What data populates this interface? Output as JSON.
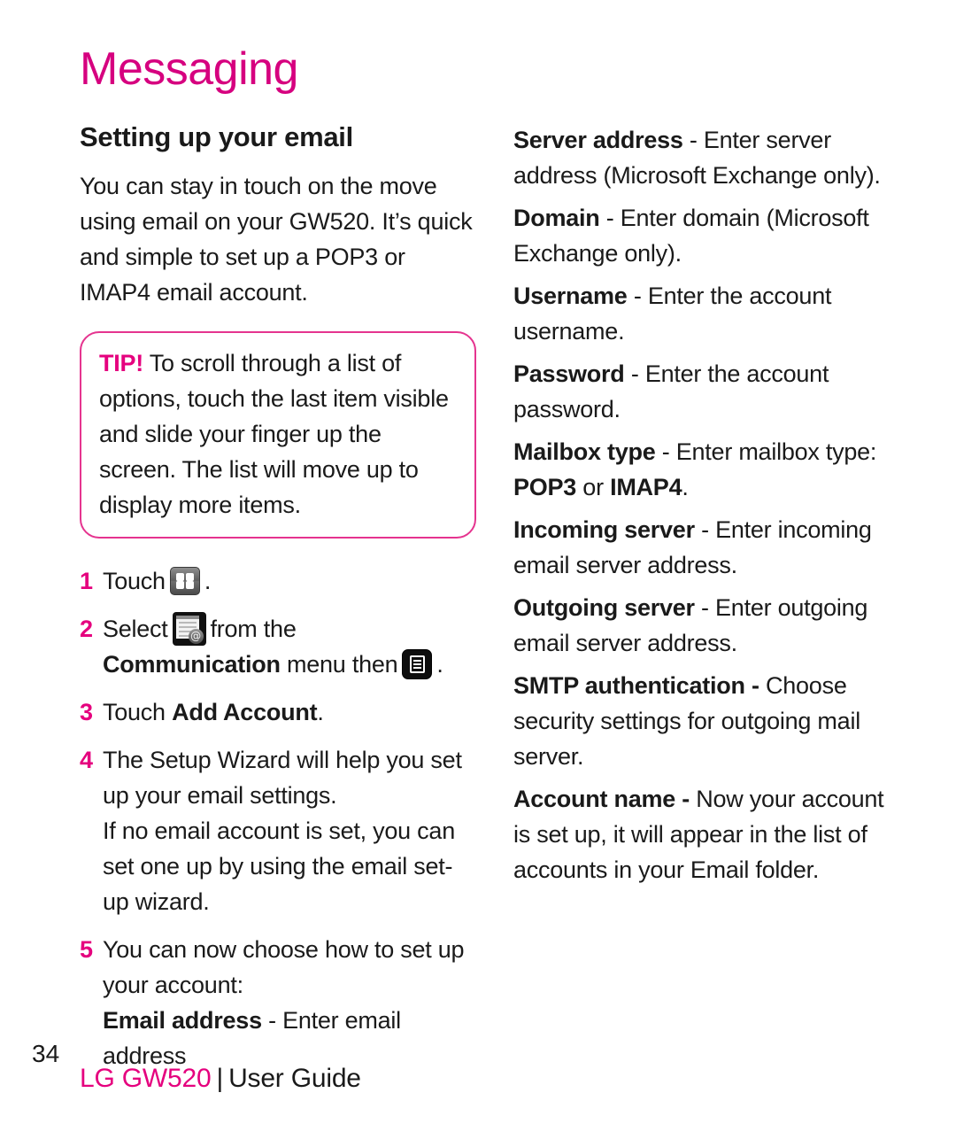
{
  "document": {
    "chapter_title": "Messaging",
    "page_number": "34",
    "footer": {
      "brand": "LG GW520",
      "separator": "|",
      "doc_type": "User Guide"
    },
    "accent_color": "#E5007E",
    "tip_border_color": "#E5348F"
  },
  "left_column": {
    "section_heading": "Setting up your email",
    "intro_paragraph": "You can stay in touch on the move using email on your GW520. It’s quick and simple to set up a POP3 or IMAP4 email account.",
    "tip": {
      "label": "TIP!",
      "text": " To scroll through a list of options, touch the last item visible and slide your finger up the screen. The list will move up to display more items."
    },
    "steps": [
      {
        "number": "1",
        "text_before": "Touch",
        "icon": "grid-menu-icon",
        "text_after": "."
      },
      {
        "number": "2",
        "text_before": "Select",
        "icon": "email-app-icon",
        "text_middle": "from the",
        "bold_term": "Communication",
        "text_after": "menu then",
        "icon_2": "options-list-icon",
        "text_end": "."
      },
      {
        "number": "3",
        "text_before": "Touch",
        "bold_term": "Add Account",
        "text_after": "."
      },
      {
        "number": "4",
        "text_before": "The Setup Wizard will help you set up your email settings.",
        "sub_paragraph": "If no email account is set, you can set one up by using the email set-up wizard."
      },
      {
        "number": "5",
        "text_before": "You can now choose how to set up your account:",
        "field_label": "Email address",
        "field_dash": "-",
        "field_desc": "Enter email address"
      }
    ]
  },
  "right_column": {
    "fields": [
      {
        "label": "Server address",
        "dash": " - ",
        "description": "Enter server address (Microsoft Exchange only)."
      },
      {
        "label": "Domain",
        "dash": " - ",
        "description": "Enter domain (Microsoft Exchange only)."
      },
      {
        "label": "Username",
        "dash": " - ",
        "description": "Enter the account username."
      },
      {
        "label": "Password",
        "dash": " - ",
        "description": "Enter the account password."
      },
      {
        "label": "Mailbox type",
        "dash": " - ",
        "description": "Enter mailbox type: ",
        "bold_value_1": "POP3",
        "value_conjunction": " or ",
        "bold_value_2": "IMAP4",
        "description_end": "."
      },
      {
        "label": "Incoming server",
        "dash": " - ",
        "description": "Enter incoming email server address."
      },
      {
        "label": "Outgoing server",
        "dash": " - ",
        "description": "Enter outgoing email server address."
      },
      {
        "label": "SMTP authentication -",
        "dash": " ",
        "description": "Choose security settings for outgoing mail server."
      },
      {
        "label": "Account name -",
        "dash": " ",
        "description": "Now your account is set up, it will appear in the list of accounts in your Email folder."
      }
    ]
  }
}
